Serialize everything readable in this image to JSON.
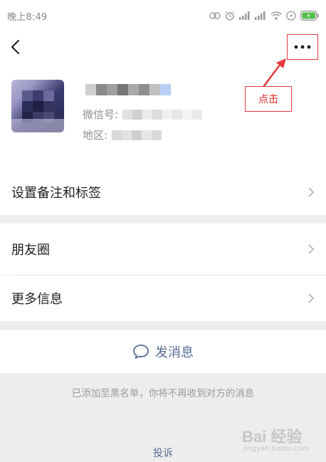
{
  "status_bar": {
    "time": "晚上8:49",
    "icons": [
      "alarm-icon",
      "alarm-clock-icon",
      "signal-icon",
      "signal-icon",
      "wifi-icon",
      "charging-icon",
      "battery-icon"
    ]
  },
  "nav": {
    "back_icon": "back-arrow-icon",
    "more_icon": "more-dots-icon"
  },
  "profile": {
    "wechat_id_label": "微信号:",
    "region_label": "地区:"
  },
  "annotation": {
    "callout_text": "点击",
    "color": "#e33a3a"
  },
  "cells": {
    "remark_tags": "设置备注和标签",
    "moments": "朋友圈",
    "more_info": "更多信息"
  },
  "actions": {
    "send_message": "发消息",
    "blacklist_note": "已添加至黑名单，你将不再收到对方的消息",
    "complain": "投诉"
  },
  "watermark": {
    "brand": "Bai 经验",
    "sub": "jingyan.baidu.com"
  },
  "colors": {
    "link_blue": "#576b95",
    "text": "#1f1f1f",
    "muted": "#9b9b9b",
    "background": "#ededed"
  }
}
